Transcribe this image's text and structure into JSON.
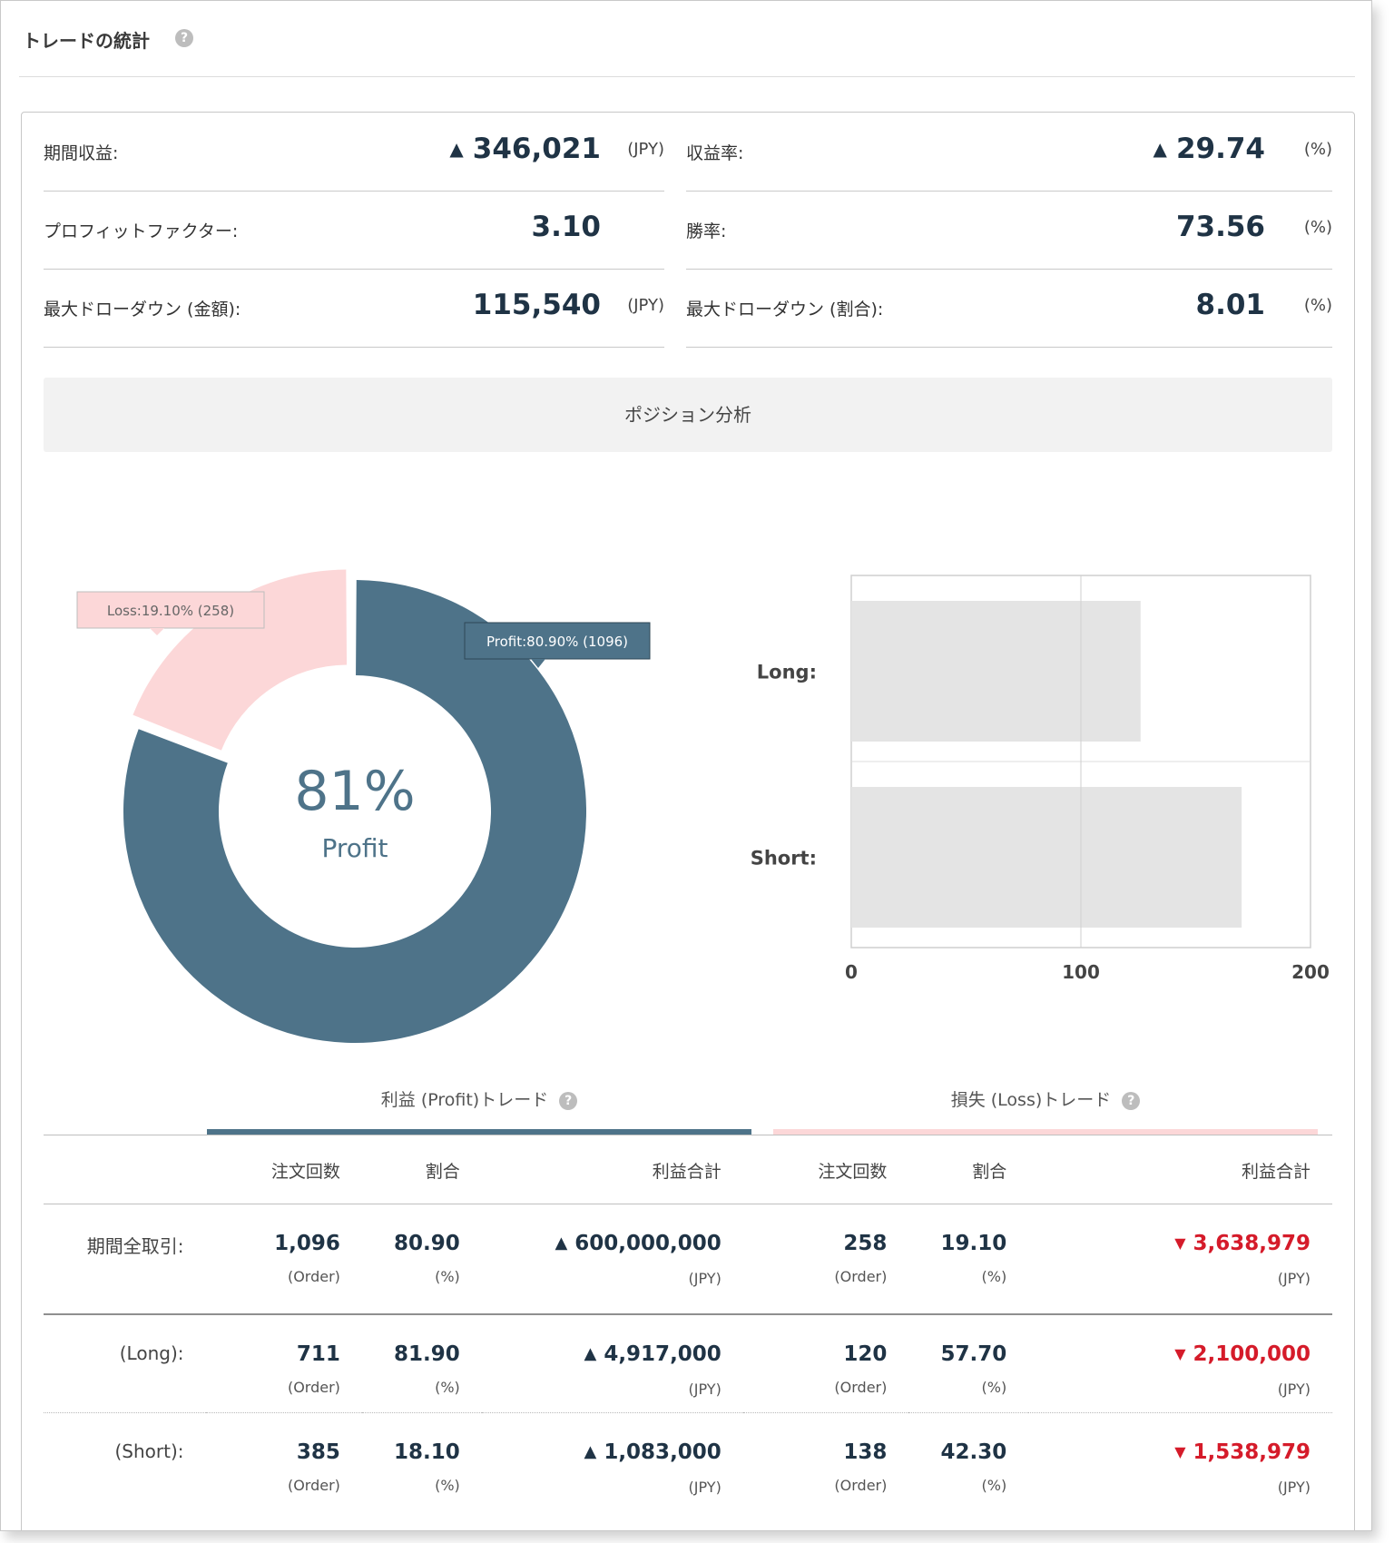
{
  "page": {
    "title": "トレードの統計",
    "help_glyph": "?"
  },
  "stats": {
    "period_profit": {
      "label": "期間収益:",
      "value": "346,021",
      "unit": "(JPY)",
      "trend": "up"
    },
    "return_rate": {
      "label": "収益率:",
      "value": "29.74",
      "unit": "(%)",
      "trend": "up"
    },
    "profit_factor": {
      "label": "プロフィットファクター:",
      "value": "3.10",
      "unit": ""
    },
    "win_rate": {
      "label": "勝率:",
      "value": "73.56",
      "unit": "(%)"
    },
    "max_dd_amount": {
      "label": "最大ドローダウン (金額):",
      "value": "115,540",
      "unit": "(JPY)"
    },
    "max_dd_ratio": {
      "label": "最大ドローダウン (割合):",
      "value": "8.01",
      "unit": "(%)"
    }
  },
  "position_analysis": {
    "label": "ポジション分析"
  },
  "chart_data": [
    {
      "type": "pie",
      "style": "donut",
      "center_text": {
        "value": "81%",
        "label": "Profit"
      },
      "slices": [
        {
          "name": "Profit",
          "percent": 80.9,
          "count": 1096,
          "color": "#4e7389",
          "tooltip": "Profit:80.90% (1096)"
        },
        {
          "name": "Loss",
          "percent": 19.1,
          "count": 258,
          "color": "#fcd7d8",
          "tooltip": "Loss:19.10% (258)"
        }
      ]
    },
    {
      "type": "bar",
      "orientation": "horizontal",
      "categories": [
        "Long:",
        "Short:"
      ],
      "values": [
        126,
        170
      ],
      "xlim": [
        0,
        200
      ],
      "xticks": [
        "0",
        "100",
        "200"
      ],
      "grid": true,
      "bar_color": "#e4e4e4"
    }
  ],
  "tabs": {
    "profit": {
      "label": "利益 (Profit)トレード",
      "color": "#4e7389"
    },
    "loss": {
      "label": "損失 (Loss)トレード",
      "color": "#fcd7d8"
    }
  },
  "table": {
    "headers": [
      "注文回数",
      "割合",
      "利益合計",
      "注文回数",
      "割合",
      "利益合計"
    ],
    "units": {
      "order": "(Order)",
      "pct": "(%)",
      "jpy": "(JPY)"
    },
    "rows": [
      {
        "label": "期間全取引:",
        "p_orders": "1,096",
        "p_pct": "80.90",
        "p_total": "600,000,000",
        "l_orders": "258",
        "l_pct": "19.10",
        "l_total": "3,638,979"
      },
      {
        "label": "(Long):",
        "p_orders": "711",
        "p_pct": "81.90",
        "p_total": "4,917,000",
        "l_orders": "120",
        "l_pct": "57.70",
        "l_total": "2,100,000"
      },
      {
        "label": "(Short):",
        "p_orders": "385",
        "p_pct": "18.10",
        "p_total": "1,083,000",
        "l_orders": "138",
        "l_pct": "42.30",
        "l_total": "1,538,979"
      }
    ]
  },
  "colors": {
    "profit_up": "#1f3345",
    "loss_down": "#d51b2a"
  }
}
